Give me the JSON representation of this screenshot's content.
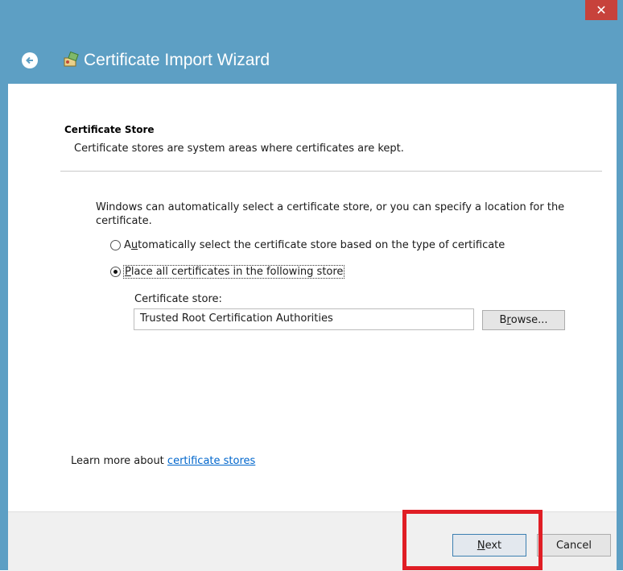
{
  "window": {
    "title": "Certificate Import Wizard",
    "close_label": "✕",
    "back_glyph": "←"
  },
  "section": {
    "title": "Certificate Store",
    "description": "Certificate stores are system areas where certificates are kept."
  },
  "intro": "Windows can automatically select a certificate store, or you can specify a location for the certificate.",
  "options": [
    {
      "pre": "A",
      "accel": "u",
      "post": "tomatically select the certificate store based on the type of certificate",
      "checked": false
    },
    {
      "pre": "",
      "accel": "P",
      "post": "lace all certificates in the following store",
      "checked": true
    }
  ],
  "store": {
    "label": "Certificate store:",
    "value": "Trusted Root Certification Authorities",
    "browse_pre": "B",
    "browse_accel": "r",
    "browse_post": "owse..."
  },
  "learn": {
    "prefix": "Learn more about ",
    "link": "certificate stores"
  },
  "footer": {
    "next_accel": "N",
    "next_post": "ext",
    "cancel": "Cancel"
  },
  "colors": {
    "title_bar": "#5d9fc4",
    "close": "#c7423b",
    "highlight": "#e01e25",
    "link": "#0066cc"
  }
}
